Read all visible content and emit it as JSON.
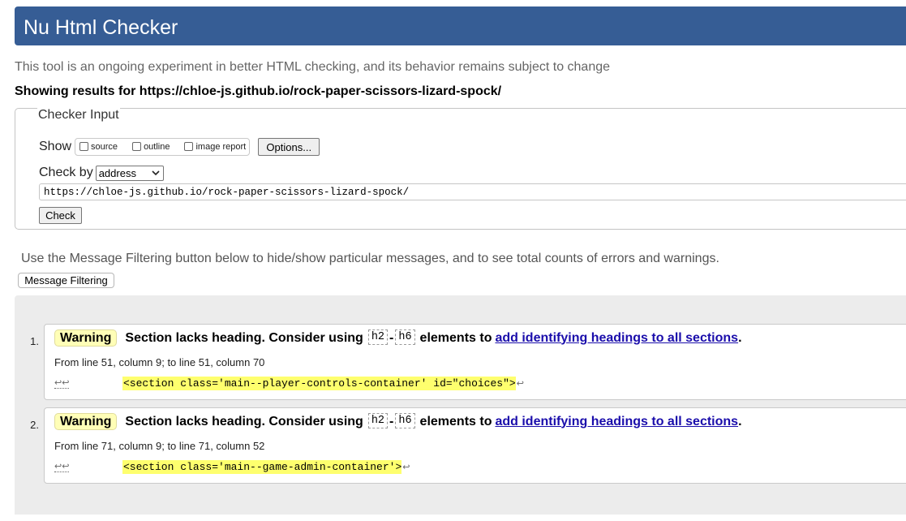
{
  "header": {
    "title": "Nu Html Checker"
  },
  "intro": "This tool is an ongoing experiment in better HTML checking, and its behavior remains subject to change",
  "results_for": "Showing results for https://chloe-js.github.io/rock-paper-scissors-lizard-spock/",
  "checker_input": {
    "legend": "Checker Input",
    "show_label": "Show",
    "checkboxes": [
      "source",
      "outline",
      "image report"
    ],
    "options_label": "Options...",
    "check_by_label": "Check by",
    "check_by_value": "address",
    "url_value": "https://chloe-js.github.io/rock-paper-scissors-lizard-spock/",
    "check_button": "Check"
  },
  "filtering": {
    "note": "Use the Message Filtering button below to hide/show particular messages, and to see total counts of errors and warnings.",
    "button": "Message Filtering"
  },
  "messages": [
    {
      "number": "1.",
      "badge": "Warning",
      "text": "Section lacks heading. Consider using",
      "code1": "h2",
      "dash": "-",
      "code2": "h6",
      "text2": "elements to",
      "link": "add identifying headings to all sections",
      "period": ".",
      "location": "From line 51, column 9; to line 51, column 70",
      "prefix": "↩↩",
      "extract": "<section class='main--player-controls-container' id=\"choices\">",
      "suffix": "↩"
    },
    {
      "number": "2.",
      "badge": "Warning",
      "text": "Section lacks heading. Consider using",
      "code1": "h2",
      "dash": "-",
      "code2": "h6",
      "text2": "elements to",
      "link": "add identifying headings to all sections",
      "period": ".",
      "location": "From line 71, column 9; to line 71, column 52",
      "prefix": "↩↩",
      "extract": "<section class='main--game-admin-container'>",
      "suffix": "↩"
    }
  ],
  "colors": {
    "title_bar": "#365d95",
    "warning_badge": "#fffeb7",
    "extract_highlight": "#feff6e",
    "link": "#1a0dab",
    "results_panel": "#ececec"
  }
}
